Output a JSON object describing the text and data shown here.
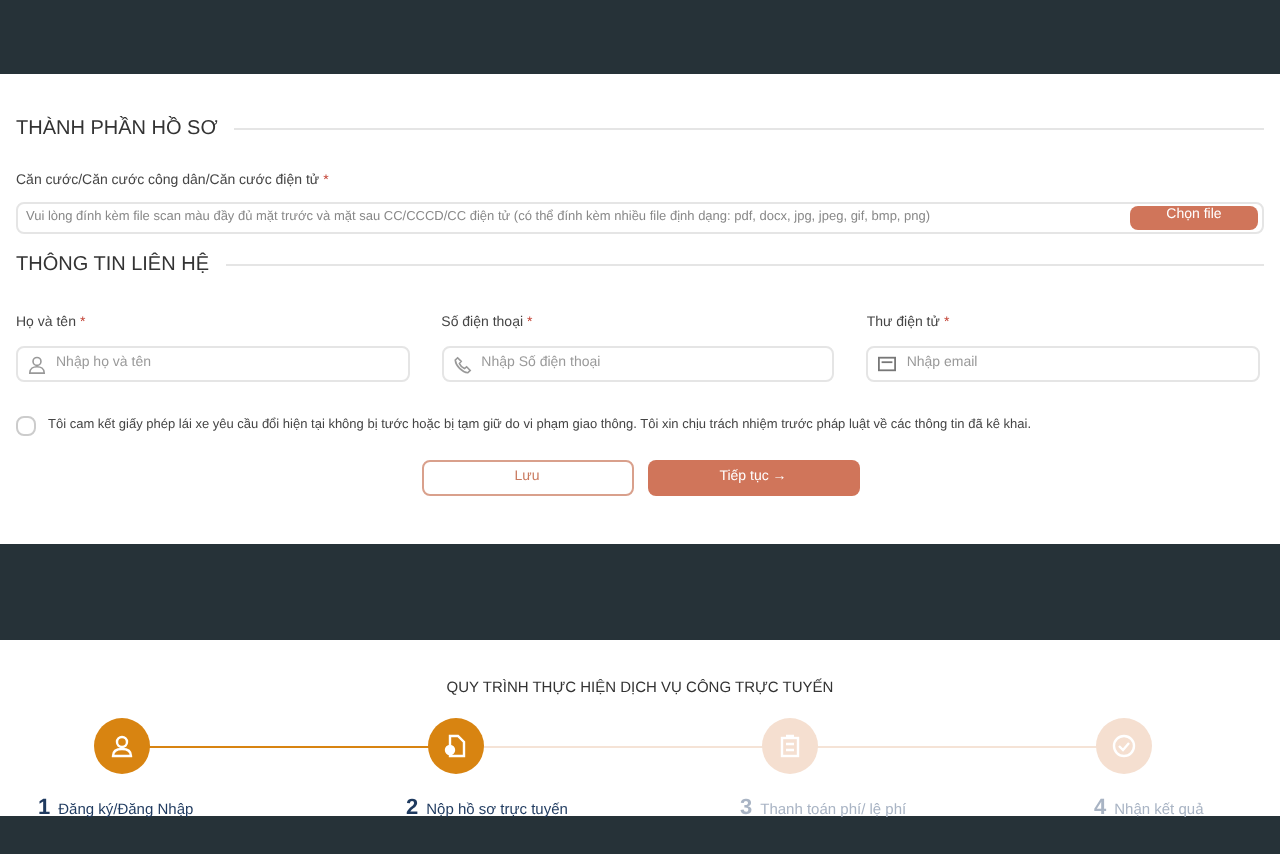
{
  "documents_section": {
    "title": "THÀNH PHẦN HỒ SƠ",
    "upload": {
      "label": "Căn cước/Căn cước công dân/Căn cước điện tử",
      "required_mark": "*",
      "placeholder": "Vui lòng đính kèm file scan màu đầy đủ mặt trước và mặt sau CC/CCCD/CC điện tử (có thể đính kèm nhiều file định dạng: pdf, docx, jpg, jpeg, gif, bmp, png)",
      "button": "Chọn file"
    }
  },
  "contact_section": {
    "title": "THÔNG TIN LIÊN HỆ",
    "fields": [
      {
        "label": "Họ và tên",
        "required_mark": "*",
        "placeholder": "Nhập họ và tên",
        "kind": "person"
      },
      {
        "label": "Số điện thoại",
        "required_mark": "*",
        "placeholder": "Nhập Số điện thoại",
        "kind": "phone"
      },
      {
        "label": "Thư điện tử",
        "required_mark": "*",
        "placeholder": "Nhập email",
        "kind": "email"
      }
    ]
  },
  "agreement": {
    "text": "Tôi cam kết giấy phép lái xe yêu cầu đổi hiện tại không bị tước hoặc bị tạm giữ do vi phạm giao thông. Tôi xin chịu trách nhiệm trước pháp luật về các thông tin đã kê khai.",
    "checked": false
  },
  "buttons": {
    "save": "Lưu",
    "next": "Tiếp tục →"
  },
  "process": {
    "title": "QUY TRÌNH THỰC HIỆN DỊCH VỤ CÔNG TRỰC TUYẾN",
    "steps": [
      {
        "number": "1",
        "label": "Đăng ký/Đăng Nhập",
        "completed": true,
        "kind": "user"
      },
      {
        "number": "2",
        "label": "Nộp hồ sơ trực tuyến",
        "completed": true,
        "kind": "document"
      },
      {
        "number": "3",
        "label": "Thanh toán phí/ lệ phí",
        "completed": false,
        "kind": "clipboard"
      },
      {
        "number": "4",
        "label": "Nhận kết quả",
        "completed": false,
        "kind": "check"
      }
    ]
  }
}
